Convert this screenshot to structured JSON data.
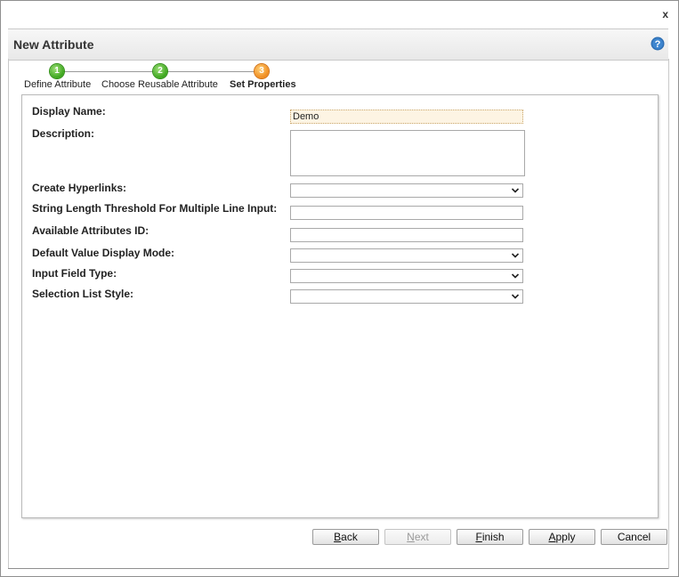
{
  "dialog": {
    "close_label": "x",
    "title": "New Attribute"
  },
  "wizard": {
    "steps": [
      {
        "number": "1",
        "label": "Define Attribute",
        "state": "complete"
      },
      {
        "number": "2",
        "label": "Choose Reusable Attribute",
        "state": "complete"
      },
      {
        "number": "3",
        "label": "Set Properties",
        "state": "current"
      }
    ]
  },
  "form": {
    "display_name": {
      "label": "Display Name:",
      "value": "Demo"
    },
    "description": {
      "label": "Description:",
      "value": ""
    },
    "create_hyperlinks": {
      "label": "Create Hyperlinks:",
      "value": ""
    },
    "string_length_threshold": {
      "label": "String Length Threshold For Multiple Line Input:",
      "value": ""
    },
    "available_attributes_id": {
      "label": "Available Attributes ID:",
      "value": ""
    },
    "default_value_display_mode": {
      "label": "Default Value Display Mode:",
      "value": ""
    },
    "input_field_type": {
      "label": "Input Field Type:",
      "value": ""
    },
    "selection_list_style": {
      "label": "Selection List Style:",
      "value": ""
    }
  },
  "buttons": {
    "back": {
      "first": "B",
      "rest": "ack"
    },
    "next": {
      "first": "N",
      "rest": "ext"
    },
    "finish": {
      "first": "F",
      "rest": "inish"
    },
    "apply": {
      "first": "A",
      "rest": "pply"
    },
    "cancel": "Cancel"
  },
  "colors": {
    "step_complete": "#3aa51b",
    "step_current": "#f08a1c",
    "help_icon": "#2e6fb4"
  },
  "icons": {
    "help": "help-icon",
    "close": "close-icon",
    "dropdown": "chevron-down-icon"
  }
}
